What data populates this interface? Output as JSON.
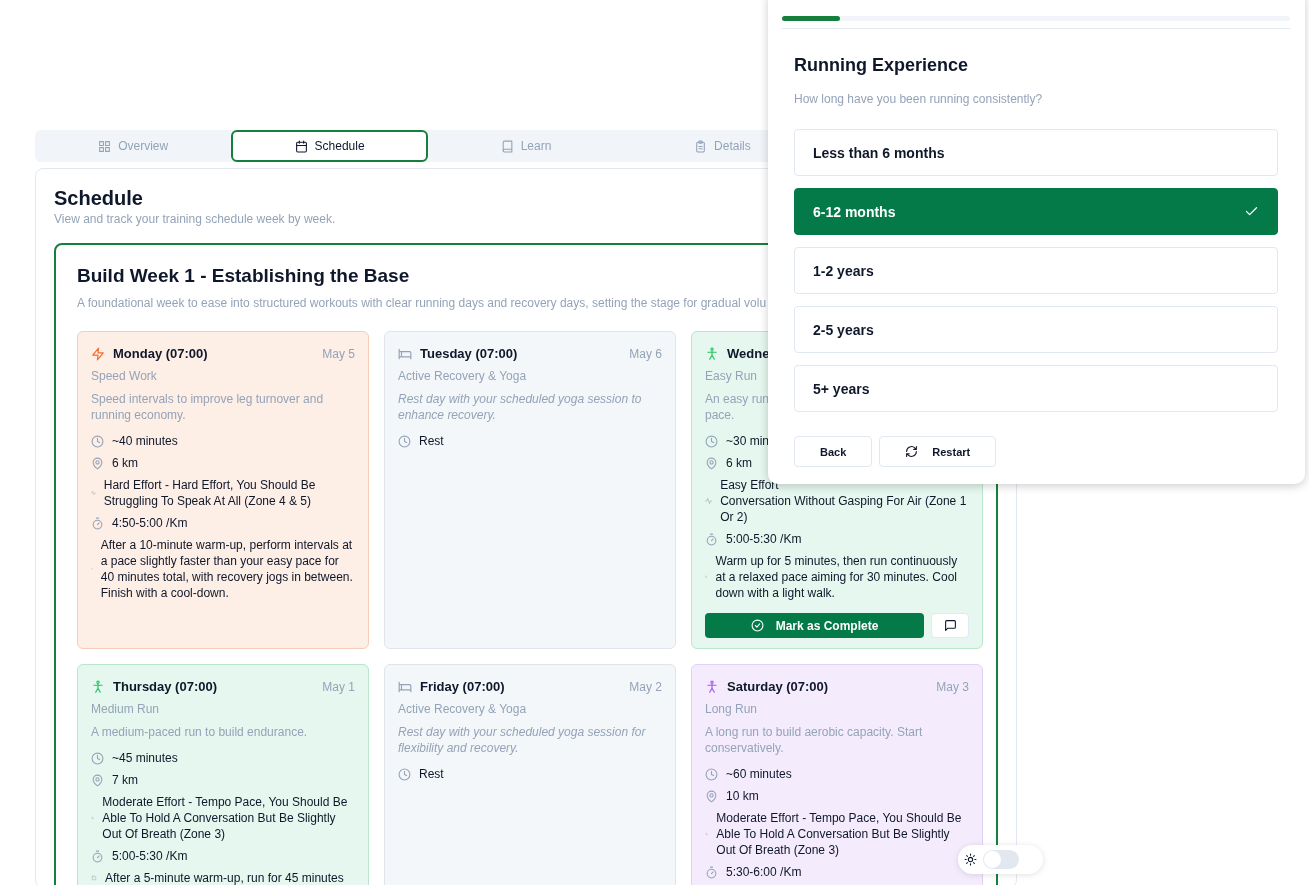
{
  "tabs": [
    {
      "label": "Overview",
      "selected": false
    },
    {
      "label": "Schedule",
      "selected": true
    },
    {
      "label": "Learn",
      "selected": false
    },
    {
      "label": "Details",
      "selected": false
    }
  ],
  "schedule": {
    "title": "Schedule",
    "subtitle": "View and track your training schedule week by week.",
    "week": {
      "title": "Build Week 1 - Establishing the Base",
      "description": "A foundational week to ease into structured workouts with clear running days and recovery days, setting the stage for gradual volu",
      "days": [
        {
          "kind": "speed",
          "day": "Monday (07:00)",
          "date": "May 5",
          "type": "Speed Work",
          "description": "Speed intervals to improve leg turnover and running economy.",
          "details": [
            {
              "kind": "duration",
              "text": "~40 minutes"
            },
            {
              "kind": "distance",
              "text": "6 km"
            },
            {
              "kind": "effort",
              "text": "Hard Effort - Hard Effort, You Should Be Struggling To Speak At All (Zone 4 & 5)"
            },
            {
              "kind": "pace",
              "text": "4:50-5:00 /Km"
            },
            {
              "kind": "note",
              "text": "After a 10-minute warm-up, perform intervals at a pace slightly faster than your easy pace for 40 minutes total, with recovery jogs in between. Finish with a cool-down."
            }
          ]
        },
        {
          "kind": "rest",
          "day": "Tuesday (07:00)",
          "date": "May 6",
          "type": "Active Recovery & Yoga",
          "description": "Rest day with your scheduled yoga session to enhance recovery.",
          "details": [
            {
              "kind": "duration",
              "text": "Rest"
            }
          ]
        },
        {
          "kind": "run",
          "day": "Wedne",
          "type": "Easy Run",
          "description": "An easy run\npace.",
          "details": [
            {
              "kind": "duration",
              "text": "~30 min"
            },
            {
              "kind": "distance",
              "text": "6 km"
            },
            {
              "kind": "effort",
              "text": "Easy Effort\nConversation Without Gasping For Air (Zone 1 Or 2)"
            },
            {
              "kind": "pace",
              "text": "5:00-5:30 /Km"
            },
            {
              "kind": "note",
              "text": "Warm up for 5 minutes, then run continuously at a relaxed pace aiming for 30 minutes. Cool down with a light walk."
            }
          ],
          "action": "Mark as Complete"
        },
        {
          "kind": "run",
          "day": "Thursday (07:00)",
          "date": "May 1",
          "type": "Medium Run",
          "description": "A medium-paced run to build endurance.",
          "details": [
            {
              "kind": "duration",
              "text": "~45 minutes"
            },
            {
              "kind": "distance",
              "text": "7 km"
            },
            {
              "kind": "effort",
              "text": "Moderate Effort - Tempo Pace, You Should Be Able To Hold A Conversation But Be Slightly Out Of Breath (Zone 3)"
            },
            {
              "kind": "pace",
              "text": "5:00-5:30 /Km"
            },
            {
              "kind": "note",
              "text": "After a 5-minute warm-up, run for 45 minutes"
            }
          ]
        },
        {
          "kind": "rest",
          "day": "Friday (07:00)",
          "date": "May 2",
          "type": "Active Recovery & Yoga",
          "description": "Rest day with your scheduled yoga session for flexibility and recovery.",
          "details": [
            {
              "kind": "duration",
              "text": "Rest"
            }
          ]
        },
        {
          "kind": "long",
          "day": "Saturday (07:00)",
          "date": "May 3",
          "type": "Long Run",
          "description": "A long run to build aerobic capacity. Start conservatively.",
          "details": [
            {
              "kind": "duration",
              "text": "~60 minutes"
            },
            {
              "kind": "distance",
              "text": "10 km"
            },
            {
              "kind": "effort",
              "text": "Moderate Effort - Tempo Pace, You Should Be Able To Hold A Conversation But Be Slightly Out Of Breath (Zone 3)"
            },
            {
              "kind": "pace",
              "text": "5:30-6:00 /Km"
            }
          ]
        }
      ]
    }
  },
  "questionnaire": {
    "progress": {
      "level": 0.115
    },
    "title": "Running Experience",
    "question": "How long have you been running consistently?",
    "options": [
      {
        "label": "Less than 6 months",
        "selected": false
      },
      {
        "label": "6-12 months",
        "selected": true
      },
      {
        "label": "1-2 years",
        "selected": false
      },
      {
        "label": "2-5 years",
        "selected": false
      },
      {
        "label": "5+ years",
        "selected": false
      }
    ],
    "back": "Back",
    "restart": "Restart"
  },
  "theme_toggle": {
    "on": false
  }
}
